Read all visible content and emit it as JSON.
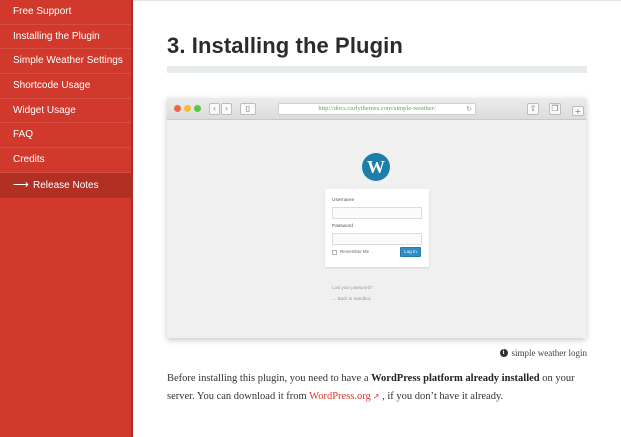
{
  "sidebar": {
    "items": [
      {
        "label": "Free Support",
        "active": false
      },
      {
        "label": "Installing the Plugin",
        "active": false
      },
      {
        "label": "Simple Weather Settings",
        "active": false
      },
      {
        "label": "Shortcode Usage",
        "active": false
      },
      {
        "label": "Widget Usage",
        "active": false
      },
      {
        "label": "FAQ",
        "active": false
      },
      {
        "label": "Credits",
        "active": false
      },
      {
        "label": "Release Notes",
        "active": true,
        "icon": "arrow-right-icon"
      }
    ],
    "bg_color": "#d2392d",
    "active_color": "#b22f24"
  },
  "main": {
    "title": "3. Installing the Plugin",
    "screenshot": {
      "url": "http://docs.curlythemes.com/simple-weather/",
      "username_label": "Username",
      "password_label": "Password",
      "remember_label": "Remember Me",
      "login_button": "Log In",
      "lost_password": "Lost your password?",
      "back_link": "← Back to Sandbox"
    },
    "caption": "simple weather login",
    "paragraph": {
      "part1": "Before installing this plugin, you need to have a ",
      "bold": "WordPress platform already installed",
      "part2": " on your server. You can download it from ",
      "link": "WordPress.org",
      "part3": " , if you don’t have it already."
    },
    "link_color": "#d2392d"
  }
}
